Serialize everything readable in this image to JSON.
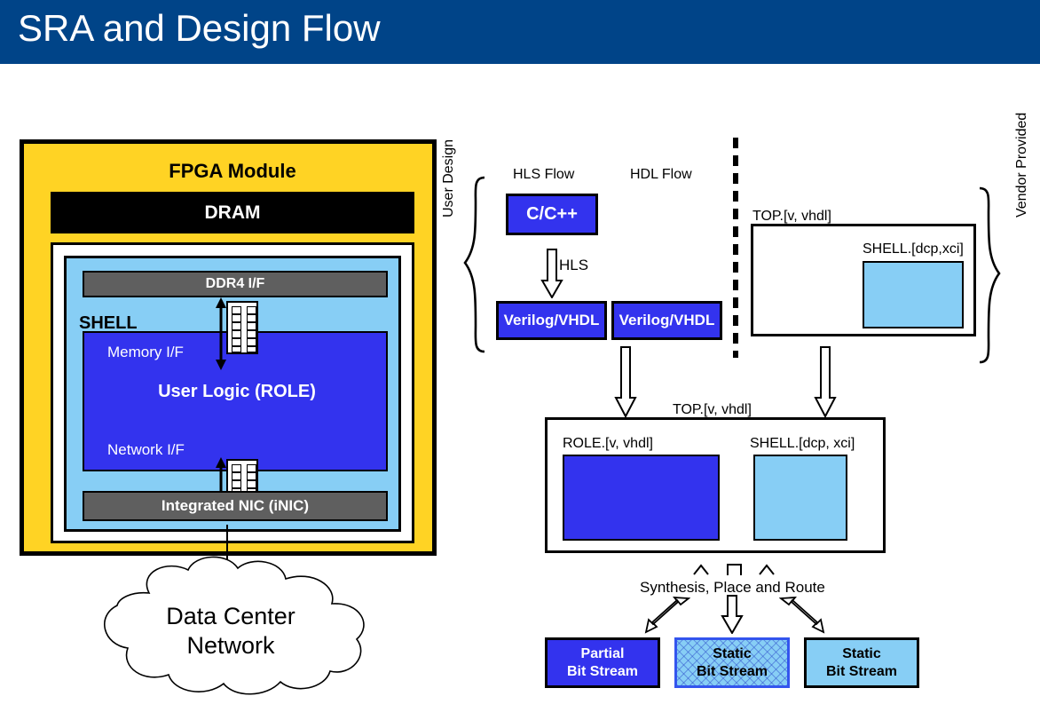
{
  "header": {
    "title": "SRA and Design Flow",
    "background_color": "#004488",
    "text_color": "#ffffff"
  },
  "colors": {
    "header_blue": "#004488",
    "module_yellow": "#FFD324",
    "royal_blue": "#3333EE",
    "light_blue": "#87CEF5",
    "interface_gray": "#5F5F5F",
    "black": "#000000",
    "white": "#ffffff"
  },
  "fpga_module": {
    "title": "FPGA Module",
    "dram_label": "DRAM",
    "shell_label": "SHELL",
    "ddr4_if_label": "DDR4 I/F",
    "memory_if_label": "Memory I/F",
    "role_label": "User Logic (ROLE)",
    "network_if_label": "Network I/F",
    "inic_label": "Integrated NIC (iNIC)"
  },
  "cloud": {
    "label": "Data Center\nNetwork",
    "line1": "Data Center",
    "line2": "Network"
  },
  "design_flow": {
    "hls_flow_label": "HLS Flow",
    "hdl_flow_label": "HDL Flow",
    "user_design_brace_label": "User Design",
    "vendor_provided_brace_label": "Vendor Provided",
    "cpp_box_label": "C/C++",
    "hls_arrow_label": "HLS",
    "verilog_hls_label": "Verilog/VHDL",
    "verilog_hdl_label": "Verilog/VHDL",
    "vendor_top_label": "TOP.[v, vhdl]",
    "vendor_shell_label": "SHELL.[dcp,xci]",
    "merge_top_label": "TOP.[v, vhdl]",
    "role_file_label": "ROLE.[v, vhdl]",
    "shell_file_label": "SHELL.[dcp, xci]",
    "synthesis_label": "Synthesis, Place and Route",
    "bitstreams": [
      {
        "line1": "Partial",
        "line2": "Bit Stream",
        "style": "solid-blue"
      },
      {
        "line1": "Static",
        "line2": "Bit Stream",
        "style": "hatched-light-blue"
      },
      {
        "line1": "Static",
        "line2": "Bit Stream",
        "style": "light-blue"
      }
    ]
  }
}
